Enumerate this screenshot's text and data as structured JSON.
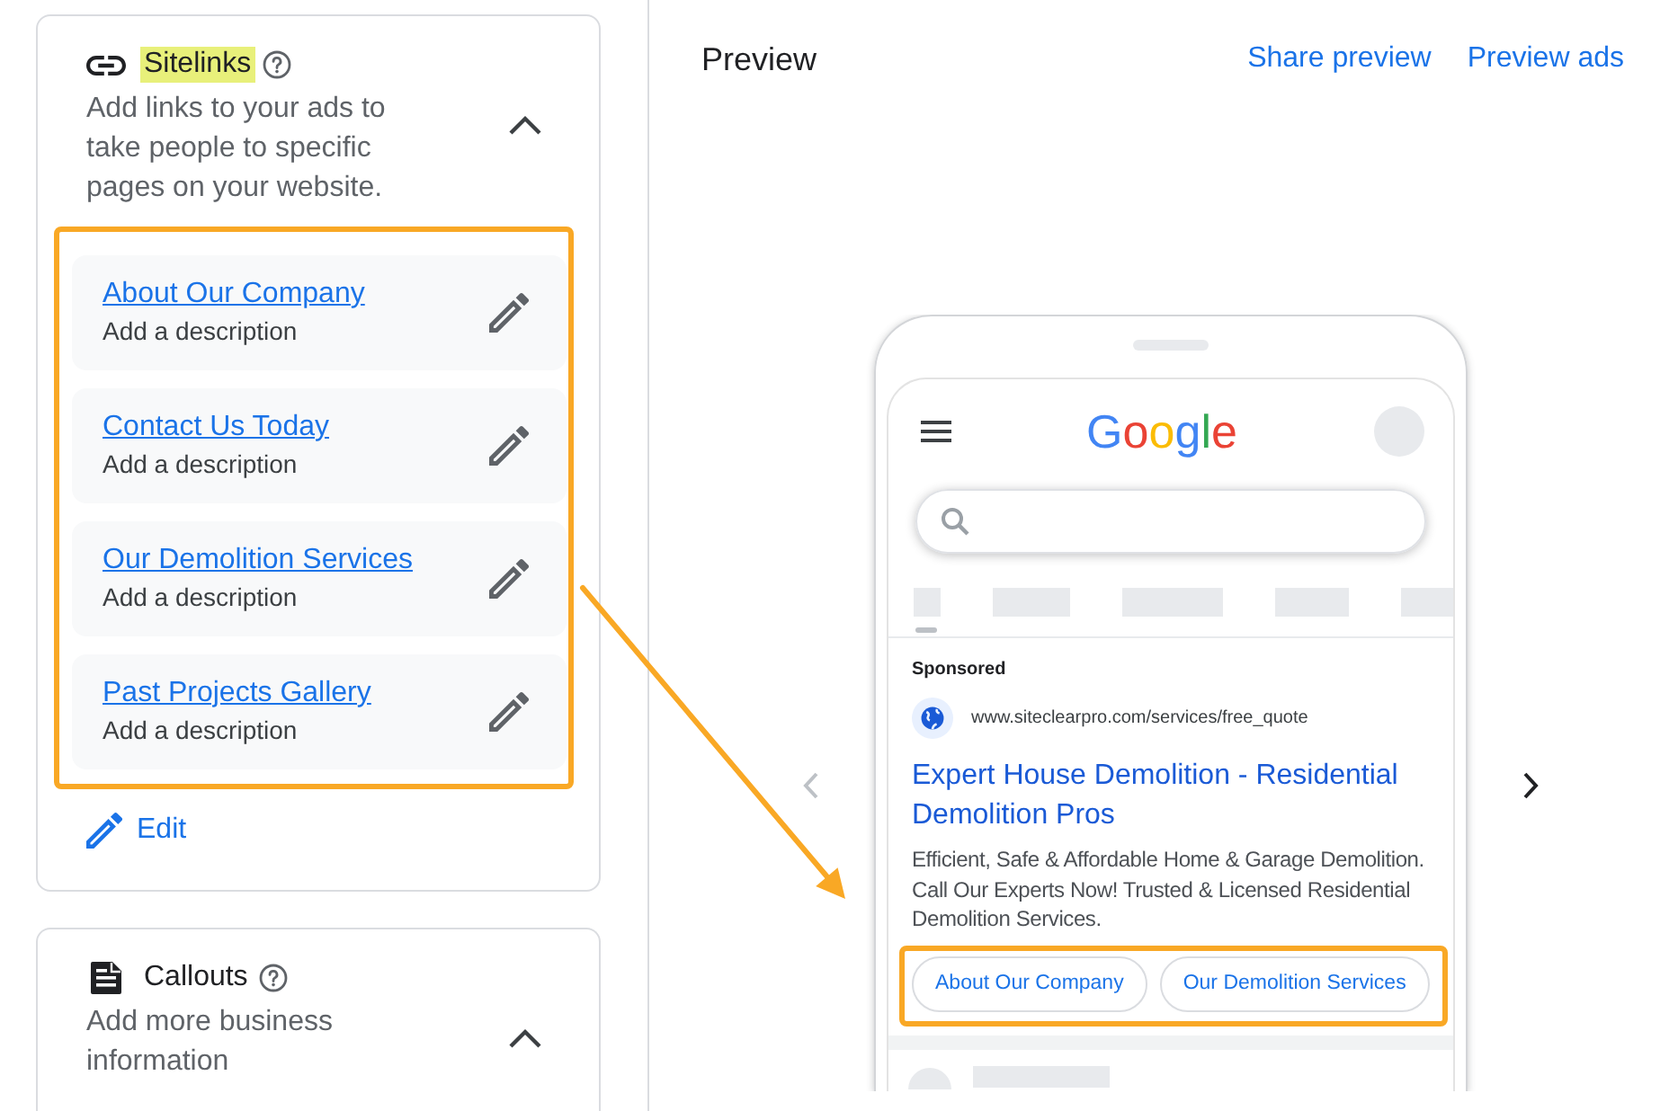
{
  "settings": {
    "sections": [
      {
        "kind": "sitelinks",
        "title": "Sitelinks",
        "title_highlighted": true,
        "description": "Add links to your ads to take people to specific pages on your website.",
        "expanded": true,
        "items_outlined": true,
        "items": [
          {
            "title": "About Our Company",
            "description": "Add a description"
          },
          {
            "title": "Contact Us Today",
            "description": "Add a description"
          },
          {
            "title": "Our Demolition Services",
            "description": "Add a description"
          },
          {
            "title": "Past Projects Gallery",
            "description": "Add a description"
          }
        ],
        "edit_label": "Edit"
      },
      {
        "kind": "callouts",
        "title": "Callouts",
        "title_highlighted": false,
        "description": "Add more business information",
        "expanded": true
      }
    ]
  },
  "preview": {
    "title": "Preview",
    "actions": [
      "Share preview",
      "Preview ads"
    ],
    "previous_disabled": true,
    "next_disabled": false,
    "phone": {
      "logo": "Google",
      "ad": {
        "label": "Sponsored",
        "url": "www.siteclearpro.com/services/free_quote",
        "headline": "Expert House Demolition - Residential Demolition Pros",
        "description": "Efficient, Safe & Affordable Home & Garage Demolition. Call Our Experts Now! Trusted & Licensed Residential Demolition Services.",
        "sitelinks_outlined": true,
        "sitelinks": [
          "About Our Company",
          "Our Demolition Services"
        ]
      }
    }
  },
  "annotation_arrow": true
}
